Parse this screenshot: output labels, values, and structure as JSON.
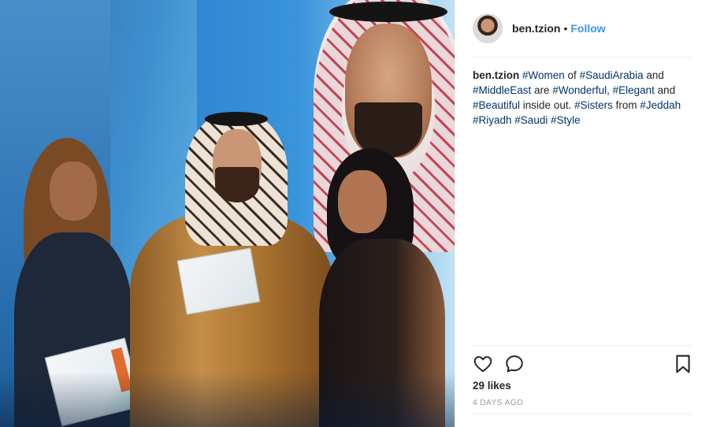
{
  "post": {
    "username": "ben.tzion",
    "separator": "•",
    "follow_label": "Follow"
  },
  "caption": {
    "username": "ben.tzion",
    "segments": [
      {
        "text": " ",
        "tag": false
      },
      {
        "text": "#Women",
        "tag": true
      },
      {
        "text": " of ",
        "tag": false
      },
      {
        "text": "#SaudiArabia",
        "tag": true
      },
      {
        "text": " and ",
        "tag": false
      },
      {
        "text": "#MiddleEast",
        "tag": true
      },
      {
        "text": " are ",
        "tag": false
      },
      {
        "text": "#Wonderful",
        "tag": true
      },
      {
        "text": ", ",
        "tag": false
      },
      {
        "text": "#Elegant",
        "tag": true
      },
      {
        "text": " and ",
        "tag": false
      },
      {
        "text": "#Beautiful",
        "tag": true
      },
      {
        "text": " inside out. ",
        "tag": false
      },
      {
        "text": "#Sisters",
        "tag": true
      },
      {
        "text": " from ",
        "tag": false
      },
      {
        "text": "#Jeddah",
        "tag": true
      },
      {
        "text": " ",
        "tag": false
      },
      {
        "text": "#Riyadh",
        "tag": true
      },
      {
        "text": " ",
        "tag": false
      },
      {
        "text": "#Saudi",
        "tag": true
      },
      {
        "text": " ",
        "tag": false
      },
      {
        "text": "#Style",
        "tag": true
      }
    ]
  },
  "actions": {
    "like_icon": "heart-icon",
    "comment_icon": "comment-bubble-icon",
    "save_icon": "bookmark-icon"
  },
  "likes_label": "29 likes",
  "timestamp": "4 DAYS AGO",
  "colors": {
    "link_blue": "#3897f0",
    "hashtag": "#003569",
    "text": "#262626",
    "muted": "#999999",
    "border": "#efefef"
  }
}
